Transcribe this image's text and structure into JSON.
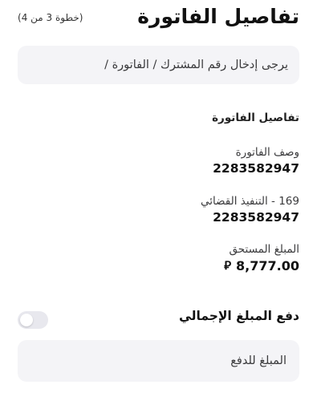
{
  "header": {
    "title": "تفاصيل الفاتورة",
    "step": "(خطوة 3 من 4)"
  },
  "search": {
    "placeholder": "يرجى إدخال رقم المشترك / الفاتورة /"
  },
  "bill_details": {
    "section_title": "تفاصيل الفاتورة",
    "fields": [
      {
        "label": "وصف الفاتورة",
        "value": "2283582947"
      },
      {
        "label": "169 - التنفيذ القضائي",
        "value": "2283582947"
      }
    ],
    "amount_due": {
      "label": "المبلغ المستحق",
      "value": "8,777.00",
      "currency": "⃁"
    }
  },
  "payment": {
    "pay_full_label": "دفع المبلغ الإجمالي",
    "pay_full_enabled": false,
    "amount_placeholder": "المبلغ للدفع"
  }
}
